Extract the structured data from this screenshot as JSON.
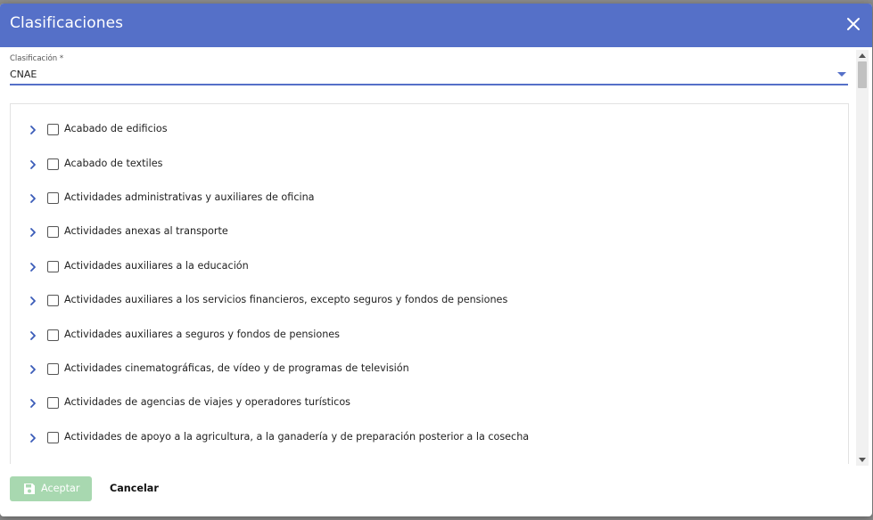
{
  "dialog": {
    "title": "Clasificaciones",
    "close_icon": "close-icon"
  },
  "field": {
    "label": "Clasificación *",
    "value": "CNAE"
  },
  "tree": {
    "items": [
      {
        "label": "Acabado de edificios",
        "checked": false
      },
      {
        "label": "Acabado de textiles",
        "checked": false
      },
      {
        "label": "Actividades administrativas y auxiliares de oficina",
        "checked": false
      },
      {
        "label": "Actividades anexas al transporte",
        "checked": false
      },
      {
        "label": "Actividades auxiliares a la educación",
        "checked": false
      },
      {
        "label": "Actividades auxiliares a los servicios financieros, excepto seguros y fondos de pensiones",
        "checked": false
      },
      {
        "label": "Actividades auxiliares a seguros y fondos de pensiones",
        "checked": false
      },
      {
        "label": "Actividades cinematográficas, de vídeo y de programas de televisión",
        "checked": false
      },
      {
        "label": "Actividades de agencias de viajes y operadores turísticos",
        "checked": false
      },
      {
        "label": "Actividades de apoyo a la agricultura, a la ganadería y de preparación posterior a la cosecha",
        "checked": false
      }
    ]
  },
  "footer": {
    "accept_label": "Aceptar",
    "cancel_label": "Cancelar",
    "accept_icon": "save-icon"
  },
  "colors": {
    "header": "#5570c8",
    "accent": "#5570c8",
    "accept_disabled": "#a8d8b0"
  }
}
